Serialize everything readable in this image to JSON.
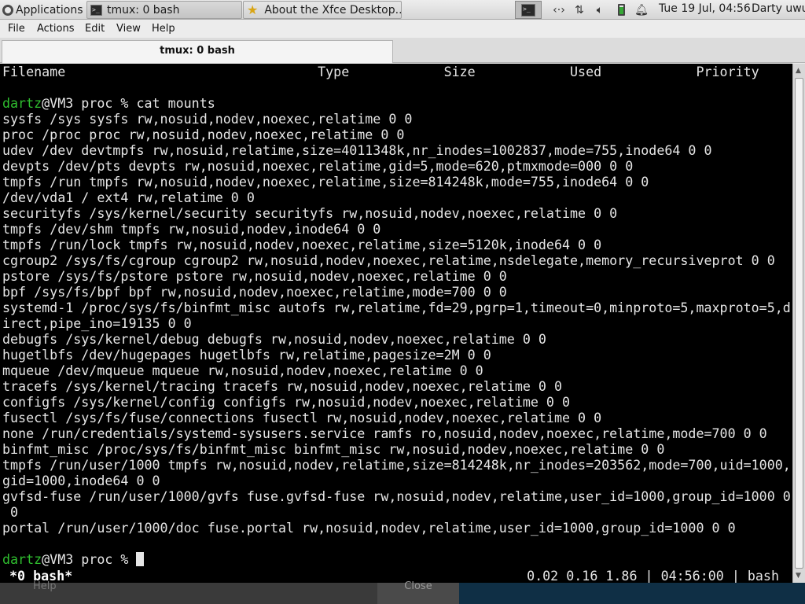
{
  "panel": {
    "applications_label": "Applications",
    "tasks": [
      {
        "label": "tmux: 0 bash",
        "icon": "terminal-icon"
      },
      {
        "label": "About the Xfce Desktop...",
        "icon": "star-icon"
      }
    ],
    "clock": "Tue 19 Jul, 04:56",
    "user": "Darty uwu"
  },
  "window": {
    "menu": [
      "File",
      "Actions",
      "Edit",
      "View",
      "Help"
    ],
    "tab_title": "tmux: 0 bash"
  },
  "terminal": {
    "header_row": "Filename                                Type            Size            Used            Priority",
    "prompt_user": "dartz",
    "prompt_rest": "@VM3 proc % ",
    "command": "cat mounts",
    "output": [
      "sysfs /sys sysfs rw,nosuid,nodev,noexec,relatime 0 0",
      "proc /proc proc rw,nosuid,nodev,noexec,relatime 0 0",
      "udev /dev devtmpfs rw,nosuid,relatime,size=4011348k,nr_inodes=1002837,mode=755,inode64 0 0",
      "devpts /dev/pts devpts rw,nosuid,noexec,relatime,gid=5,mode=620,ptmxmode=000 0 0",
      "tmpfs /run tmpfs rw,nosuid,nodev,noexec,relatime,size=814248k,mode=755,inode64 0 0",
      "/dev/vda1 / ext4 rw,relatime 0 0",
      "securityfs /sys/kernel/security securityfs rw,nosuid,nodev,noexec,relatime 0 0",
      "tmpfs /dev/shm tmpfs rw,nosuid,nodev,inode64 0 0",
      "tmpfs /run/lock tmpfs rw,nosuid,nodev,noexec,relatime,size=5120k,inode64 0 0",
      "cgroup2 /sys/fs/cgroup cgroup2 rw,nosuid,nodev,noexec,relatime,nsdelegate,memory_recursiveprot 0 0",
      "pstore /sys/fs/pstore pstore rw,nosuid,nodev,noexec,relatime 0 0",
      "bpf /sys/fs/bpf bpf rw,nosuid,nodev,noexec,relatime,mode=700 0 0",
      "systemd-1 /proc/sys/fs/binfmt_misc autofs rw,relatime,fd=29,pgrp=1,timeout=0,minproto=5,maxproto=5,d",
      "irect,pipe_ino=19135 0 0",
      "debugfs /sys/kernel/debug debugfs rw,nosuid,nodev,noexec,relatime 0 0",
      "hugetlbfs /dev/hugepages hugetlbfs rw,relatime,pagesize=2M 0 0",
      "mqueue /dev/mqueue mqueue rw,nosuid,nodev,noexec,relatime 0 0",
      "tracefs /sys/kernel/tracing tracefs rw,nosuid,nodev,noexec,relatime 0 0",
      "configfs /sys/kernel/config configfs rw,nosuid,nodev,noexec,relatime 0 0",
      "fusectl /sys/fs/fuse/connections fusectl rw,nosuid,nodev,noexec,relatime 0 0",
      "none /run/credentials/systemd-sysusers.service ramfs ro,nosuid,nodev,noexec,relatime,mode=700 0 0",
      "binfmt_misc /proc/sys/fs/binfmt_misc binfmt_misc rw,nosuid,nodev,noexec,relatime 0 0",
      "tmpfs /run/user/1000 tmpfs rw,nosuid,nodev,relatime,size=814248k,nr_inodes=203562,mode=700,uid=1000,",
      "gid=1000,inode64 0 0",
      "gvfsd-fuse /run/user/1000/gvfs fuse.gvfsd-fuse rw,nosuid,nodev,relatime,user_id=1000,group_id=1000 0",
      " 0",
      "portal /run/user/1000/doc fuse.portal rw,nosuid,nodev,relatime,user_id=1000,group_id=1000 0 0"
    ],
    "status_left": "*0 bash*",
    "status_right": "0.02 0.16 1.86 | 04:56:00 | bash"
  },
  "behind": {
    "help_label": "Help",
    "close_label": "Close"
  },
  "colors": {
    "prompt_user": "#2fbf2f",
    "terminal_bg": "#000000",
    "terminal_fg": "#e6e6e6"
  }
}
